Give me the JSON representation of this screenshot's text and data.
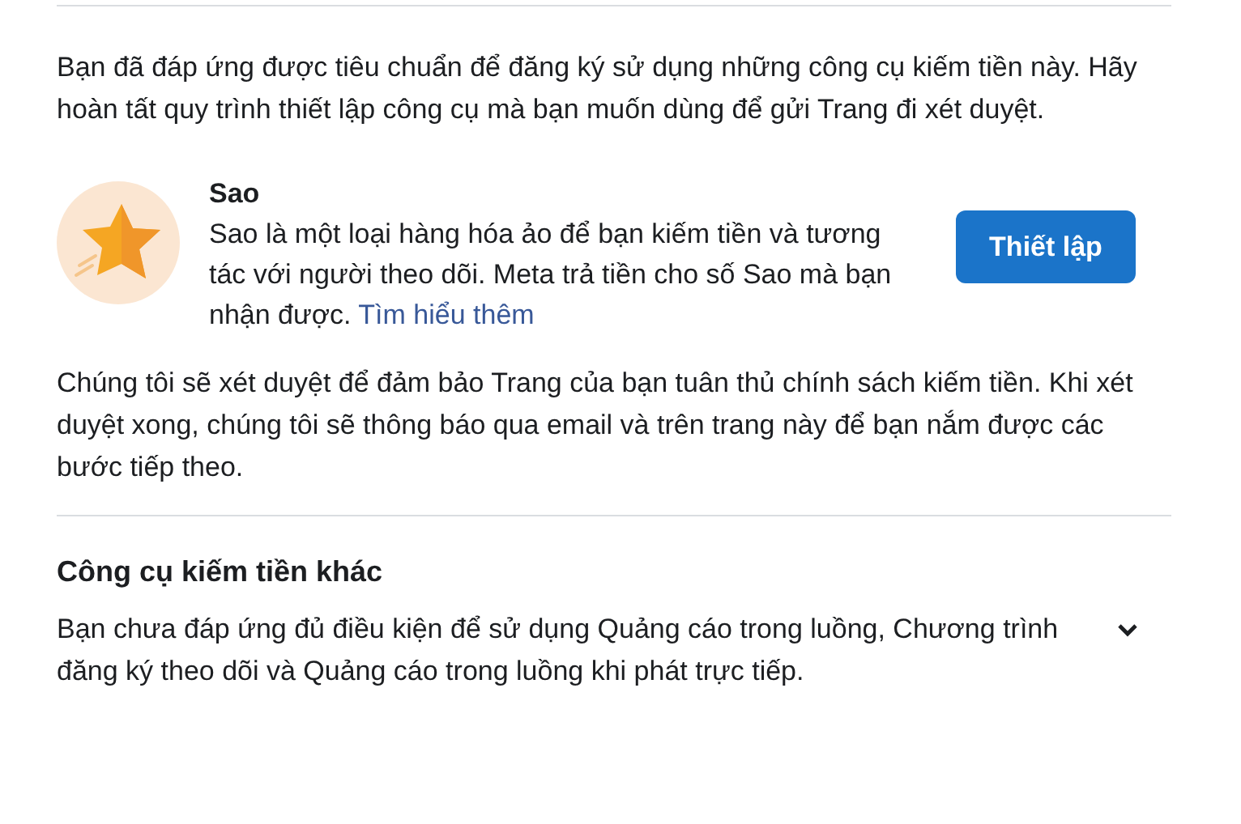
{
  "intro": "Bạn đã đáp ứng được tiêu chuẩn để đăng ký sử dụng những công cụ kiếm tiền này. Hãy hoàn tất quy trình thiết lập công cụ mà bạn muốn dùng để gửi Trang đi xét duyệt.",
  "tools": [
    {
      "title": "Sao",
      "description": "Sao là một loại hàng hóa ảo để bạn kiếm tiền và tương tác với người theo dõi. Meta trả tiền cho số Sao mà bạn nhận được.",
      "link": "Tìm hiểu thêm",
      "button": "Thiết lập"
    }
  ],
  "review_note": "Chúng tôi sẽ xét duyệt để đảm bảo Trang của bạn tuân thủ chính sách kiếm tiền. Khi xét duyệt xong, chúng tôi sẽ thông báo qua email và trên trang này để bạn nắm được các bước tiếp theo.",
  "other_tools": {
    "heading": "Công cụ kiếm tiền khác",
    "description": "Bạn chưa đáp ứng đủ điều kiện để sử dụng Quảng cáo trong luồng, Chương trình đăng ký theo dõi và Quảng cáo trong luồng khi phát trực tiếp.",
    "expanded": false
  }
}
